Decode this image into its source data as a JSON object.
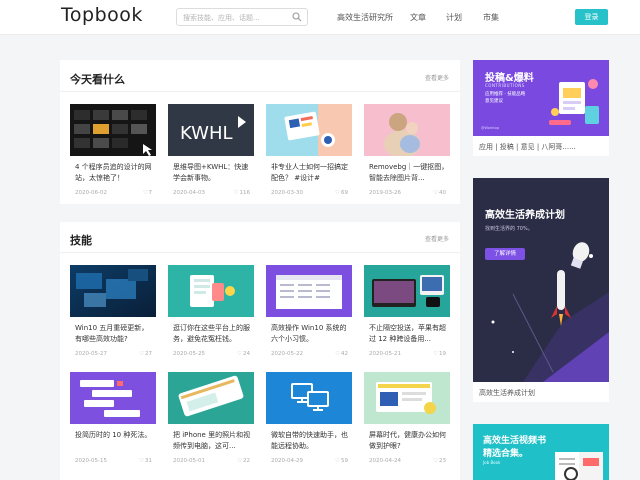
{
  "header": {
    "logo": "Topbook",
    "search_placeholder": "搜索技能、应用、话题...",
    "nav": [
      "高效生活研究所",
      "文章",
      "计划",
      "市集"
    ],
    "login": "登录"
  },
  "sections": [
    {
      "title": "今天看什么",
      "more": "查看更多",
      "items": [
        {
          "title": "4 个程序员追的设计的网站，太惊艳了！",
          "date": "2020-06-02",
          "likes": "7"
        },
        {
          "title": "思维导图+KWHL：快速学会新事物。",
          "date": "2020-04-03",
          "likes": "116"
        },
        {
          "title": "非专业人士如何一招搞定配色？ #设计#",
          "date": "2020-03-30",
          "likes": "69"
        },
        {
          "title": "Removebg｜一键抠图，智能去除图片背...",
          "date": "2019-03-26",
          "likes": "40"
        }
      ]
    },
    {
      "title": "技能",
      "more": "查看更多",
      "items": [
        {
          "title": "Win10 五月重磅更新，有哪些高效功能?",
          "date": "2020-05-27",
          "likes": "27"
        },
        {
          "title": "逛订你在这些平台上的服务，避免花冤枉钱。",
          "date": "2020-05-25",
          "likes": "24"
        },
        {
          "title": "高效操作 Win10 系统的六个小习惯。",
          "date": "2020-05-22",
          "likes": "42"
        },
        {
          "title": "不止隔空投送，苹果有超过 12 种跨设备用...",
          "date": "2020-05-21",
          "likes": "19"
        },
        {
          "title": "投简历时的 10 种死法。",
          "date": "2020-05-15",
          "likes": "31"
        },
        {
          "title": "把 iPhone 里的照片和视频传到电脑，这可...",
          "date": "2020-05-01",
          "likes": "22"
        },
        {
          "title": "微软自带的快速助手，也能远程协助。",
          "date": "2020-04-29",
          "likes": "59"
        },
        {
          "title": "屏幕时代，健康办公如何做到护眼?",
          "date": "2020-04-24",
          "likes": "23"
        }
      ]
    }
  ],
  "sidebar": {
    "card1": {
      "heading": "投稿&爆料",
      "sub": "CONTRIBUTIONS",
      "line1": "应用推荐 · 技能品略",
      "line2": "意见建议",
      "badge": "@Worktop",
      "caption": "应用 | 投稿 | 意见 | 八阿哥......"
    },
    "card2": {
      "heading": "高效生活养成计划",
      "line": "找到生活界的 70%。",
      "button": "了解详情",
      "caption": "高效生活养成计划"
    },
    "card3": {
      "heading1": "高效生活视频书",
      "heading2": "精选合集。",
      "sub": "Job Book"
    }
  },
  "thumb_text": {
    "kwhl": "KWHL",
    "win10_grid": "Win10"
  },
  "colors": {
    "brand": "#27c2c9",
    "purple": "#7b4de0",
    "dark_navy": "#2b2c45"
  }
}
